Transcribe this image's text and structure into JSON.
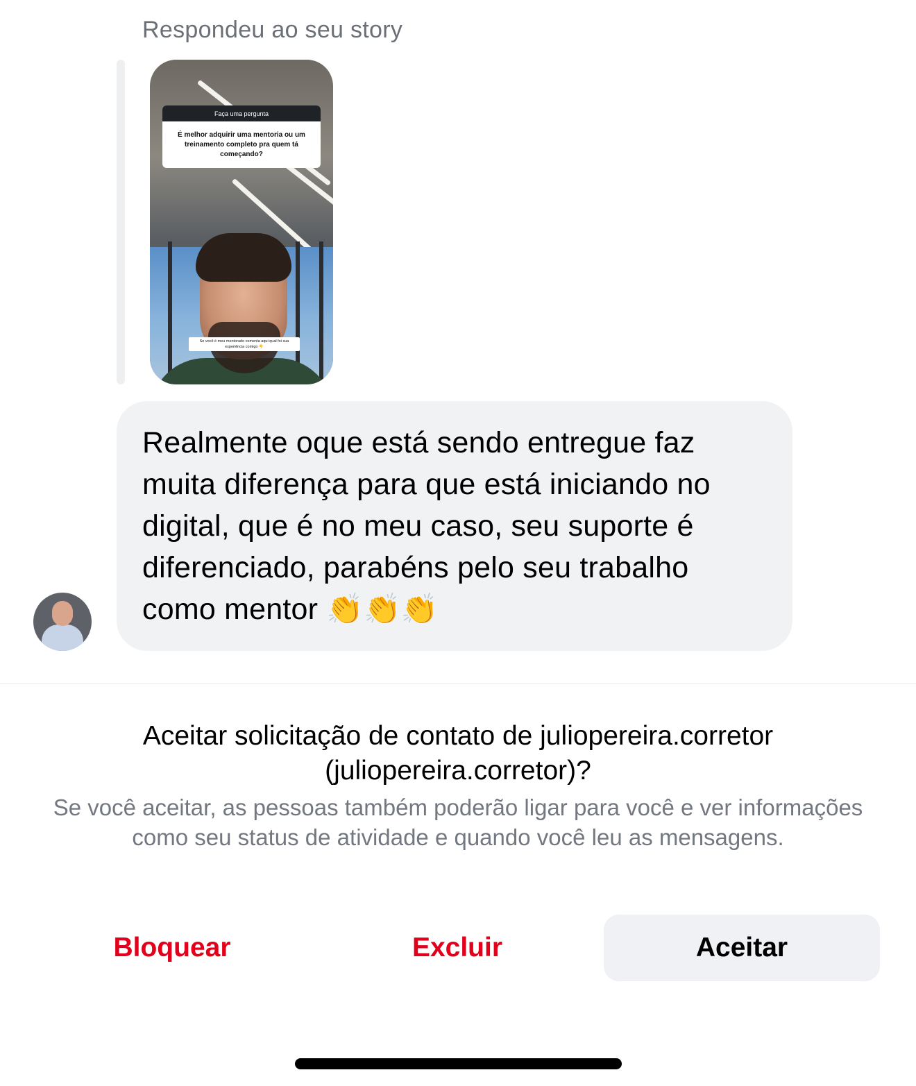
{
  "story_reply": {
    "caption": "Respondeu ao seu story",
    "question_header": "Faça uma pergunta",
    "question_text": "É melhor adquirir uma mentoria ou um treinamento completo pra quem tá começando?",
    "sticker_text": "Se você é meu mentorado comenta aqui qual foi sua experiência comigo 👇"
  },
  "message": {
    "text": "Realmente oque está sendo entregue faz muita diferença para que está iniciando no digital, que é no meu caso, seu suporte é diferenciado, parabéns pelo seu trabalho como mentor 👏👏👏"
  },
  "request": {
    "title": "Aceitar solicitação de contato de juliopereira.corretor (juliopereira.corretor)?",
    "description": "Se você aceitar, as pessoas também poderão ligar para você e ver informações como seu status de atividade e quando você leu as mensagens.",
    "block_label": "Bloquear",
    "delete_label": "Excluir",
    "accept_label": "Aceitar"
  },
  "colors": {
    "destructive": "#e3001b",
    "bubble": "#f1f2f4",
    "secondary_text": "#737880",
    "accept_button": "#eff1f4"
  }
}
